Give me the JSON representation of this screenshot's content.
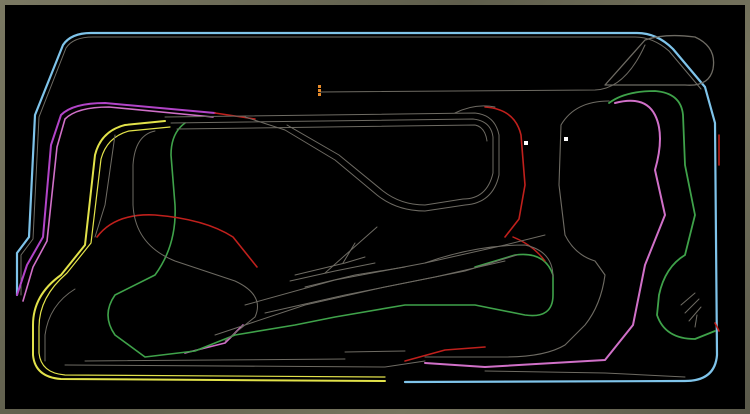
{
  "layout": {
    "station_label": "",
    "colors": {
      "background": "#000000",
      "frame": "#6b6a58",
      "track_default": "#6e6b63",
      "block_occupied": "#c0201c",
      "route_blue": "#7fc4ea",
      "route_magenta": "#b244c8",
      "route_yellow": "#e2e24a",
      "route_green": "#3fa24a",
      "route_pink": "#d070c8",
      "signal": "#e68a2a",
      "marker": "#ffffff"
    },
    "markers": [
      {
        "name": "sensor-marker-1",
        "icon": "square-marker-icon"
      },
      {
        "name": "sensor-marker-2",
        "icon": "square-marker-icon"
      }
    ]
  }
}
